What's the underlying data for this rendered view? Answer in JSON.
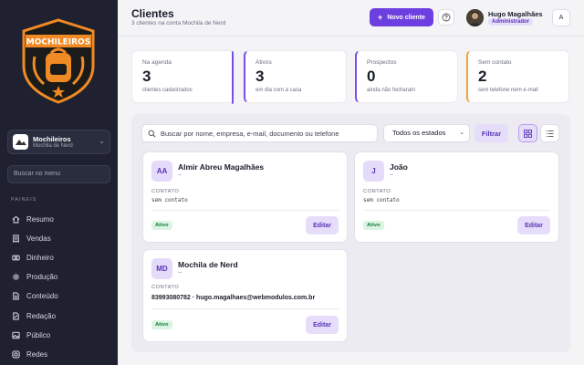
{
  "sidebar": {
    "logo_text": "MOCHILEIROS",
    "tenant": {
      "name": "Mochileiros",
      "sub": "Mochila de Nerd"
    },
    "search_placeholder": "Buscar no menu",
    "section_label": "PAINEIS",
    "items": [
      {
        "label": "Resumo",
        "icon": "home-icon"
      },
      {
        "label": "Vendas",
        "icon": "receipt-icon"
      },
      {
        "label": "Dinheiro",
        "icon": "cash-icon"
      },
      {
        "label": "Produção",
        "icon": "gear-icon"
      },
      {
        "label": "Conteúdo",
        "icon": "document-icon"
      },
      {
        "label": "Redação",
        "icon": "edit-icon"
      },
      {
        "label": "Público",
        "icon": "image-icon"
      },
      {
        "label": "Redes",
        "icon": "camera-icon"
      }
    ]
  },
  "header": {
    "title": "Clientes",
    "subtitle": "3 clientes na conta Mochila de Nerd",
    "new_button": "Novo cliente",
    "user_name": "Hugo Magalhães",
    "user_role": "Administrador",
    "a_button": "A"
  },
  "stats": [
    {
      "label": "Na agenda",
      "value": "3",
      "desc": "clientes cadastrados",
      "color": "#7b4ee6"
    },
    {
      "label": "Ativos",
      "value": "3",
      "desc": "em dia com a casa",
      "color": "#7b4ee6"
    },
    {
      "label": "Prospectos",
      "value": "0",
      "desc": "ainda não fecharam",
      "color": "#7b4ee6"
    },
    {
      "label": "Sem contato",
      "value": "2",
      "desc": "sem telefone nem e-mail",
      "color": "#f0a33a"
    }
  ],
  "toolbar": {
    "search_placeholder": "Buscar por nome, empresa, e-mail, documento ou telefone",
    "status_select": "Todos os estados",
    "filter_button": "Filtrar"
  },
  "clients": [
    {
      "initials": "AA",
      "name": "Almir Abreu Magalhães",
      "dash": "–",
      "contact_label": "CONTATO",
      "contact": "sem contato",
      "status": "Ativo",
      "edit": "Editar"
    },
    {
      "initials": "J",
      "name": "João",
      "dash": "–",
      "contact_label": "CONTATO",
      "contact": "sem contato",
      "status": "Ativo",
      "edit": "Editar"
    },
    {
      "initials": "MD",
      "name": "Mochila de Nerd",
      "dash": "–",
      "contact_label": "CONTATO",
      "contact": "83993080782 · hugo.magalhaes@webmodulos.com.br",
      "status": "Ativo",
      "edit": "Editar"
    }
  ]
}
